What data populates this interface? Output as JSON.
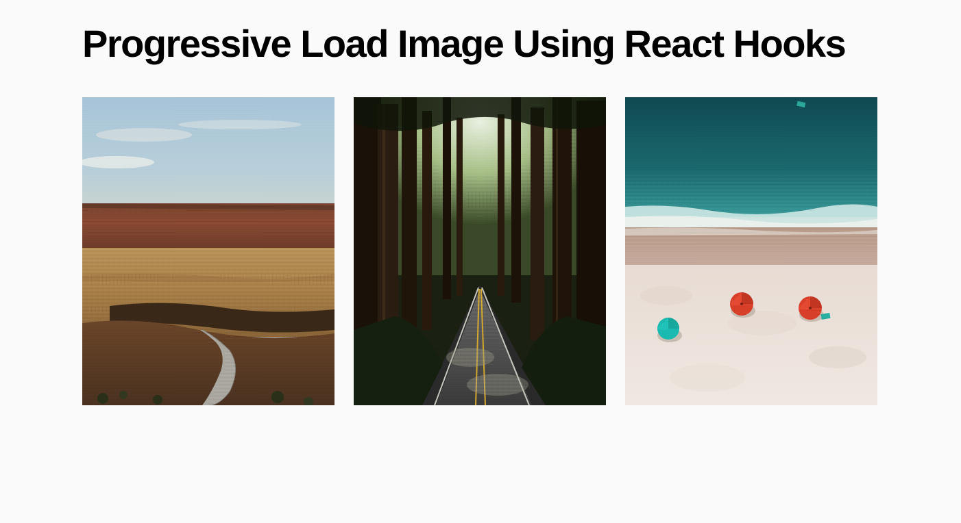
{
  "title": "Progressive Load Image Using React Hooks",
  "images": [
    {
      "name": "desert-canyon-road"
    },
    {
      "name": "redwood-forest-road"
    },
    {
      "name": "aerial-beach-umbrellas"
    }
  ]
}
